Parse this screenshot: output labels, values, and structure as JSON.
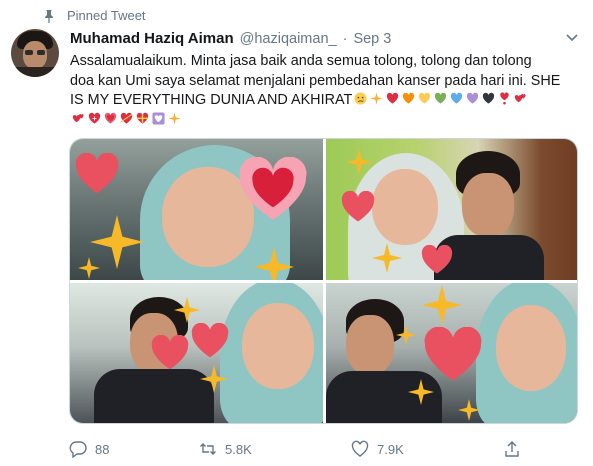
{
  "pinned": {
    "label": "Pinned Tweet"
  },
  "tweet": {
    "author_name": "Muhamad Haziq Aiman",
    "handle": "@haziqaiman_",
    "separator": "·",
    "date": "Sep 3",
    "text_line1": "Assalamualaikum. Minta jasa baik anda semua tolong, tolong dan tolong",
    "text_line2": "doa kan Umi saya selamat menjalani pembedahan kanser pada hari ini. SHE",
    "text_line3": "IS MY EVERYTHING DUNIA AND AKHIRAT",
    "emojis_line3": [
      "crying-face",
      "sparkles",
      "red-heart",
      "orange-heart",
      "yellow-heart",
      "green-heart",
      "blue-heart",
      "purple-heart",
      "black-heart",
      "heart-exclamation",
      "two-hearts"
    ],
    "emojis_line4": [
      "revolving-hearts",
      "sparkling-heart",
      "growing-heart",
      "heart-with-arrow",
      "heart-with-ribbon",
      "heart-decoration",
      "sparkles"
    ]
  },
  "media": {
    "photos": [
      "photo-1",
      "photo-2",
      "photo-3",
      "photo-4"
    ]
  },
  "actions": {
    "reply_count": "88",
    "retweet_count": "5.8K",
    "like_count": "7.9K"
  },
  "colors": {
    "text_primary": "#14171a",
    "text_secondary": "#657786",
    "border": "#ccd6dd"
  },
  "icons": [
    "pin-icon",
    "chevron-down-icon",
    "reply-icon",
    "retweet-icon",
    "like-icon",
    "share-icon"
  ]
}
